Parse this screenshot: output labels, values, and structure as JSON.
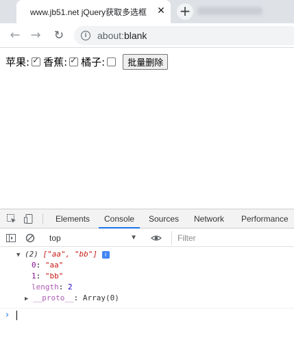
{
  "tab": {
    "title": "www.jb51.net jQuery获取多选框",
    "close": "✕",
    "new_tab": "+"
  },
  "toolbar": {
    "url_prefix": "about:",
    "url_host": "blank"
  },
  "page": {
    "items": [
      {
        "label": "苹果:",
        "checked": true
      },
      {
        "label": "香蕉:",
        "checked": true
      },
      {
        "label": "橘子:",
        "checked": false
      }
    ],
    "button_label": "批量删除"
  },
  "devtools": {
    "tabs": [
      "Elements",
      "Console",
      "Sources",
      "Network",
      "Performance"
    ],
    "active_tab": "Console",
    "context": "top",
    "filter_placeholder": "Filter",
    "console": {
      "summary_count": "(2)",
      "summary_array": "[\"aa\", \"bb\"]",
      "entries": [
        {
          "key": "0",
          "value": "\"aa\""
        },
        {
          "key": "1",
          "value": "\"bb\""
        },
        {
          "key": "length",
          "value": "2"
        }
      ],
      "proto_key": "__proto__",
      "proto_value": "Array(0)"
    }
  }
}
